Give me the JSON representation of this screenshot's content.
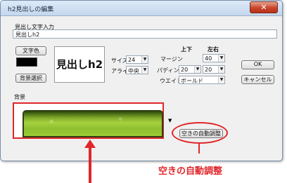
{
  "window": {
    "title": "h2見出しの編集",
    "close_glyph": "✕"
  },
  "heading_input": {
    "label": "見出し文字入力",
    "value": "見出しh2"
  },
  "buttons": {
    "text_color": "文字色",
    "bg_select": "背景選択",
    "ok": "OK",
    "cancel": "キャンセル",
    "auto_adjust": "空きの自動調整"
  },
  "preview": {
    "text": "見出しh2"
  },
  "size": {
    "label": "サイズ",
    "value": "24"
  },
  "align": {
    "label": "アライン",
    "value": "中央"
  },
  "margin": {
    "label": "マージン",
    "top_bottom_header": "上下",
    "left_right_header": "左右",
    "value": "40"
  },
  "padding": {
    "label": "パディング",
    "value1": "20",
    "value2": "20"
  },
  "weight": {
    "label": "ウエイト",
    "value": "ボールド"
  },
  "background": {
    "label": "背景"
  },
  "annotation": {
    "label": "空きの自動調整",
    "color": "#e0262a"
  },
  "icons": {
    "dropdown": "▼"
  }
}
